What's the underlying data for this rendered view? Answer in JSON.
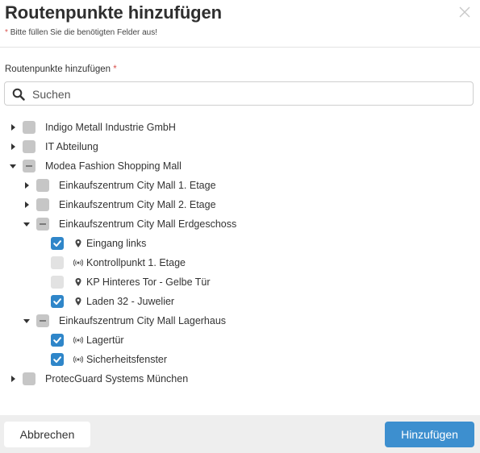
{
  "dialog": {
    "title": "Routenpunkte hinzufügen",
    "required_star": "*",
    "required_note": "Bitte füllen Sie die benötigten Felder aus!"
  },
  "field": {
    "label": "Routenpunkte hinzufügen",
    "required_star": "*"
  },
  "search": {
    "placeholder": "Suchen",
    "value": ""
  },
  "tree": [
    {
      "label": "Indigo Metall Industrie GmbH",
      "level": 0,
      "expander": "collapsed",
      "check": "unchecked",
      "icon": "none"
    },
    {
      "label": "IT Abteilung",
      "level": 0,
      "expander": "collapsed",
      "check": "unchecked",
      "icon": "none"
    },
    {
      "label": "Modea Fashion Shopping Mall",
      "level": 0,
      "expander": "expanded",
      "check": "partial",
      "icon": "none"
    },
    {
      "label": "Einkaufszentrum City Mall 1. Etage",
      "level": 1,
      "expander": "collapsed",
      "check": "unchecked",
      "icon": "none"
    },
    {
      "label": "Einkaufszentrum City Mall 2. Etage",
      "level": 1,
      "expander": "collapsed",
      "check": "unchecked",
      "icon": "none"
    },
    {
      "label": "Einkaufszentrum City Mall Erdgeschoss",
      "level": 1,
      "expander": "expanded",
      "check": "partial",
      "icon": "none"
    },
    {
      "label": "Eingang links",
      "level": 2,
      "expander": "none",
      "check": "checked",
      "icon": "map-pin-icon"
    },
    {
      "label": "Kontrollpunkt 1. Etage",
      "level": 2,
      "expander": "none",
      "check": "disabled",
      "icon": "radio-signal-icon"
    },
    {
      "label": "KP Hinteres Tor - Gelbe Tür",
      "level": 2,
      "expander": "none",
      "check": "disabled",
      "icon": "map-pin-icon"
    },
    {
      "label": "Laden 32 - Juwelier",
      "level": 2,
      "expander": "none",
      "check": "checked",
      "icon": "map-pin-icon"
    },
    {
      "label": "Einkaufszentrum City Mall Lagerhaus",
      "level": 1,
      "expander": "expanded",
      "check": "partial",
      "icon": "none"
    },
    {
      "label": "Lagertür",
      "level": 2,
      "expander": "none",
      "check": "checked",
      "icon": "radio-signal-icon"
    },
    {
      "label": "Sicherheitsfenster",
      "level": 2,
      "expander": "none",
      "check": "checked",
      "icon": "radio-signal-icon"
    },
    {
      "label": "ProtecGuard Systems München",
      "level": 0,
      "expander": "collapsed",
      "check": "unchecked",
      "icon": "none"
    }
  ],
  "footer": {
    "cancel_label": "Abbrechen",
    "add_label": "Hinzufügen"
  },
  "colors": {
    "accent": "#3d8fcf",
    "checkbox_checked": "#2f86c9",
    "required": "#d9534f"
  }
}
